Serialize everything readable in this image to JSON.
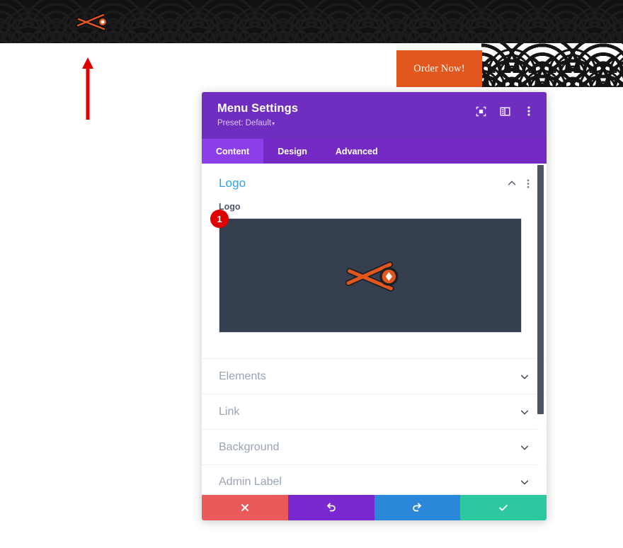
{
  "page": {
    "hero": {
      "logo_icon": "sushi-chopsticks-logo-icon",
      "background_pattern": "seigaiha-wave-pattern",
      "background_color": "#111111"
    },
    "order_button": {
      "label": "Order Now!",
      "color": "#e2571e"
    },
    "annotation": {
      "arrow_icon": "up-arrow-annotation-icon",
      "color": "#e00000"
    }
  },
  "modal": {
    "title": "Menu Settings",
    "preset_label": "Preset: Default",
    "preset_caret": "▾",
    "header_color": "#6f2ec0",
    "header_icons": [
      {
        "name": "focus-mode-icon"
      },
      {
        "name": "layout-view-icon"
      },
      {
        "name": "more-options-icon"
      }
    ],
    "tabs": [
      {
        "label": "Content",
        "active": true
      },
      {
        "label": "Design",
        "active": false
      },
      {
        "label": "Advanced",
        "active": false
      }
    ],
    "open_section": {
      "title": "Logo",
      "title_color": "#2ea3f2",
      "collapse_icon": "chevron-up-icon",
      "options_icon": "more-options-icon",
      "field_label": "Logo",
      "upload_badge": "1",
      "upload_badge_color": "#e00000",
      "upload_background": "#363f4d",
      "upload_image_icon": "sushi-chopsticks-logo-icon"
    },
    "accordion": [
      {
        "label": "Elements",
        "chevron": "chevron-down-icon"
      },
      {
        "label": "Link",
        "chevron": "chevron-down-icon"
      },
      {
        "label": "Background",
        "chevron": "chevron-down-icon"
      },
      {
        "label": "Admin Label",
        "chevron": "chevron-down-icon"
      }
    ],
    "footer_buttons": [
      {
        "name": "cancel-button",
        "icon": "close-icon",
        "glyph": "✖",
        "color": "#eb5a5a"
      },
      {
        "name": "undo-button",
        "icon": "undo-icon",
        "glyph": "↺",
        "color": "#7a29d1"
      },
      {
        "name": "redo-button",
        "icon": "redo-icon",
        "glyph": "↻",
        "color": "#2b87da"
      },
      {
        "name": "save-button",
        "icon": "check-icon",
        "glyph": "✔",
        "color": "#2cc8a0"
      }
    ],
    "scrollbar": {
      "name": "vertical-scrollbar"
    }
  }
}
